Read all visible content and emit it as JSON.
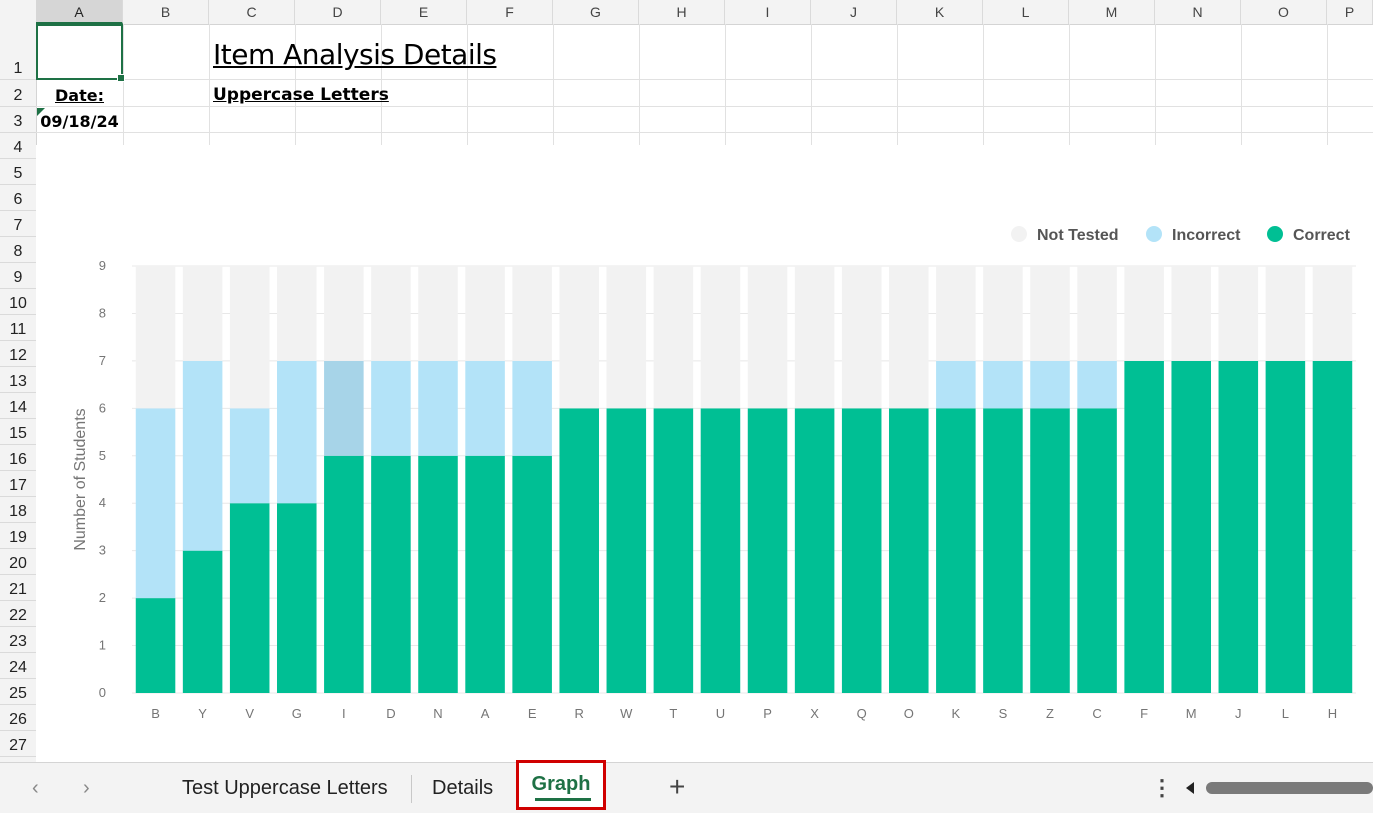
{
  "columns": [
    "A",
    "B",
    "C",
    "D",
    "E",
    "F",
    "G",
    "H",
    "I",
    "J",
    "K",
    "L",
    "M",
    "N",
    "O",
    "P"
  ],
  "rows": [
    "1",
    "2",
    "3",
    "4",
    "5",
    "6",
    "7",
    "8",
    "9",
    "10",
    "11",
    "12",
    "13",
    "14",
    "15",
    "16",
    "17",
    "18",
    "19",
    "20",
    "21",
    "22",
    "23",
    "24",
    "25",
    "26",
    "27"
  ],
  "cells": {
    "title": "Item Analysis Details",
    "subtitle": "Uppercase Letters",
    "date_label": "Date:",
    "date_value": "09/18/24"
  },
  "chart_data": {
    "type": "bar",
    "stacked": true,
    "title": "",
    "xlabel": "",
    "ylabel": "Number of Students",
    "ylim": [
      0,
      9
    ],
    "yticks": [
      0,
      1,
      2,
      3,
      4,
      5,
      6,
      7,
      8,
      9
    ],
    "legend_position": "top-right",
    "categories": [
      "B",
      "Y",
      "V",
      "G",
      "I",
      "D",
      "N",
      "A",
      "E",
      "R",
      "W",
      "T",
      "U",
      "P",
      "X",
      "Q",
      "O",
      "K",
      "S",
      "Z",
      "C",
      "F",
      "M",
      "J",
      "L",
      "H"
    ],
    "series": [
      {
        "name": "Correct",
        "color": "#00bf94",
        "values": [
          2,
          3,
          4,
          4,
          5,
          5,
          5,
          5,
          5,
          6,
          6,
          6,
          6,
          6,
          6,
          6,
          6,
          6,
          6,
          6,
          6,
          7,
          7,
          7,
          7,
          7
        ]
      },
      {
        "name": "Incorrect",
        "color": "#b3e3f8",
        "values": [
          4,
          4,
          2,
          3,
          2,
          2,
          2,
          2,
          2,
          0,
          0,
          0,
          0,
          0,
          0,
          0,
          0,
          1,
          1,
          1,
          1,
          0,
          0,
          0,
          0,
          0
        ]
      },
      {
        "name": "Not Tested",
        "color": "#f2f2f2",
        "values": [
          3,
          2,
          3,
          2,
          2,
          2,
          2,
          2,
          2,
          3,
          3,
          3,
          3,
          3,
          3,
          3,
          3,
          2,
          2,
          2,
          2,
          2,
          2,
          2,
          2,
          2
        ]
      }
    ],
    "highlight_color": "#a7d4e8"
  },
  "sheet_tabs": {
    "prev_icon": "chevron-left-icon",
    "next_icon": "chevron-right-icon",
    "tabs": [
      "Test Uppercase Letters",
      "Details",
      "Graph"
    ],
    "active_tab": "Graph",
    "add_icon": "plus-icon",
    "more_icon": "more-vertical-icon"
  }
}
